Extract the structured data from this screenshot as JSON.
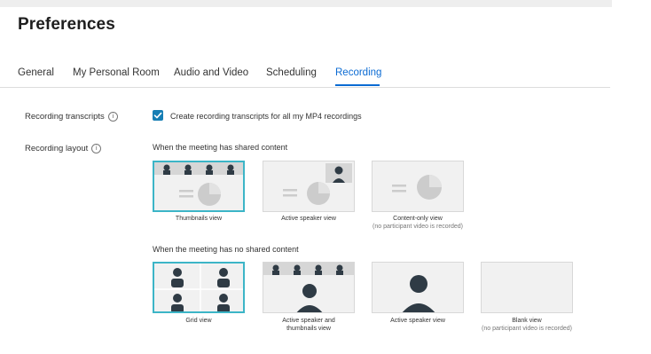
{
  "page": {
    "title": "Preferences"
  },
  "tabs": [
    {
      "label": "General"
    },
    {
      "label": "My Personal Room"
    },
    {
      "label": "Audio and Video"
    },
    {
      "label": "Scheduling"
    },
    {
      "label": "Recording",
      "active": true
    }
  ],
  "recording_transcripts": {
    "label": "Recording transcripts",
    "checkbox_label": "Create recording transcripts for all my MP4 recordings",
    "checked": true
  },
  "recording_layout": {
    "label": "Recording layout",
    "shared_heading": "When the meeting has shared content",
    "shared_options": [
      {
        "label": "Thumbnails view",
        "note": "",
        "selected": true
      },
      {
        "label": "Active speaker view",
        "note": "",
        "selected": false
      },
      {
        "label": "Content-only view",
        "note": "(no participant video is recorded)",
        "selected": false
      }
    ],
    "no_shared_heading": "When the meeting has no shared content",
    "no_shared_options": [
      {
        "label": "Grid view",
        "note": "",
        "selected": true
      },
      {
        "label": "Active speaker and",
        "label2": "thumbnails view",
        "note": "",
        "selected": false
      },
      {
        "label": "Active speaker view",
        "note": "",
        "selected": false
      },
      {
        "label": "Blank view",
        "note": "(no participant video is recorded)",
        "selected": false
      }
    ]
  },
  "colors": {
    "accent": "#0b6bd3",
    "checkbox": "#167eb4",
    "selected_border": "#3cb5c7"
  }
}
